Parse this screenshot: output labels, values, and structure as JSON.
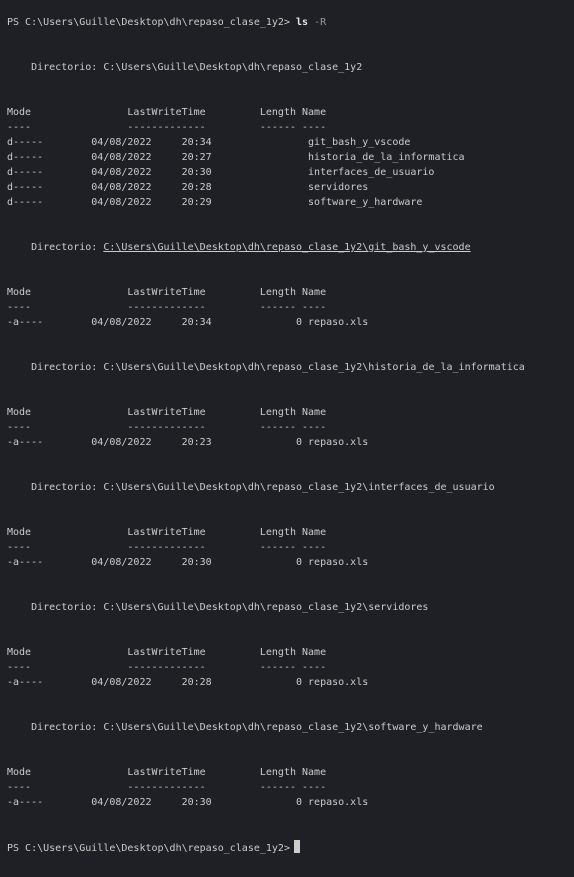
{
  "terminal": {
    "prompt_path": "PS C:\\Users\\Guille\\Desktop\\dh\\repaso_clase_1y2>",
    "command": "ls",
    "command_arg": "-R",
    "header_cols": "Mode                LastWriteTime         Length Name",
    "header_rule": "----                -------------         ------ ----",
    "sections": [
      {
        "dir_label": "Directorio: ",
        "dir_path": "C:\\Users\\Guille\\Desktop\\dh\\repaso_clase_1y2",
        "rows": [
          "d-----        04/08/2022     20:34                git_bash_y_vscode",
          "d-----        04/08/2022     20:27                historia_de_la_informatica",
          "d-----        04/08/2022     20:30                interfaces_de_usuario",
          "d-----        04/08/2022     20:28                servidores",
          "d-----        04/08/2022     20:29                software_y_hardware"
        ]
      },
      {
        "dir_label": "Directorio: ",
        "dir_path": "C:\\Users\\Guille\\Desktop\\dh\\repaso_clase_1y2\\git_bash_y_vscode",
        "rows": [
          "-a----        04/08/2022     20:34              0 repaso.xls"
        ]
      },
      {
        "dir_label": "Directorio: ",
        "dir_path": "C:\\Users\\Guille\\Desktop\\dh\\repaso_clase_1y2\\historia_de_la_informatica",
        "rows": [
          "-a----        04/08/2022     20:23              0 repaso.xls"
        ]
      },
      {
        "dir_label": "Directorio: ",
        "dir_path": "C:\\Users\\Guille\\Desktop\\dh\\repaso_clase_1y2\\interfaces_de_usuario",
        "rows": [
          "-a----        04/08/2022     20:30              0 repaso.xls"
        ]
      },
      {
        "dir_label": "Directorio: ",
        "dir_path": "C:\\Users\\Guille\\Desktop\\dh\\repaso_clase_1y2\\servidores",
        "rows": [
          "-a----        04/08/2022     20:28              0 repaso.xls"
        ]
      },
      {
        "dir_label": "Directorio: ",
        "dir_path": "C:\\Users\\Guille\\Desktop\\dh\\repaso_clase_1y2\\software_y_hardware",
        "rows": [
          "-a----        04/08/2022     20:30              0 repaso.xls"
        ]
      }
    ],
    "final_prompt": "PS C:\\Users\\Guille\\Desktop\\dh\\repaso_clase_1y2>"
  },
  "colors": {
    "background": "#1f1f26",
    "foreground": "#cccccc",
    "command": "#e5e5e5",
    "argument": "#9a9a9a"
  }
}
